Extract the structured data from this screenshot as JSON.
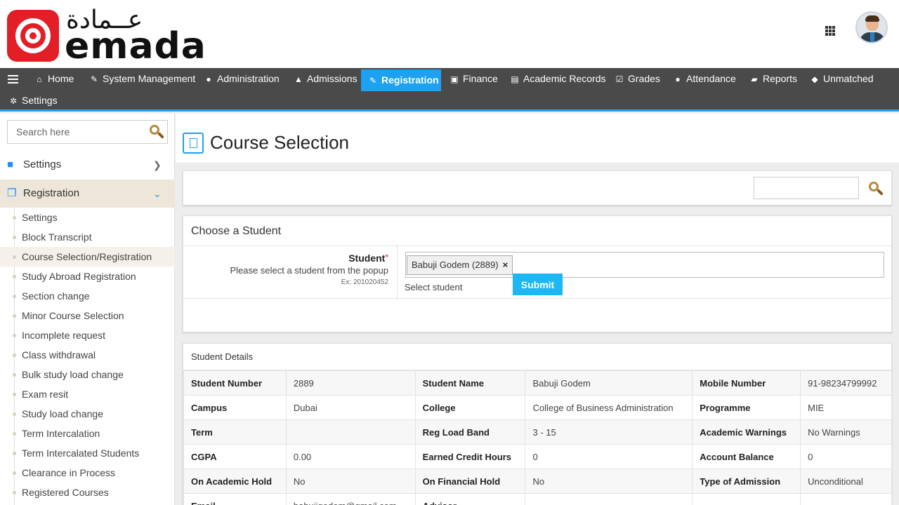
{
  "header": {
    "logo_arabic": "عــمادة",
    "logo_latin": "emada"
  },
  "nav": {
    "items": [
      {
        "label": "Home",
        "icon": "home-icon"
      },
      {
        "label": "System Management",
        "icon": "wrench-icon"
      },
      {
        "label": "Administration",
        "icon": "user-icon"
      },
      {
        "label": "Admissions",
        "icon": "graduation-cap-icon"
      },
      {
        "label": "Registration",
        "icon": "edit-icon",
        "active": true
      },
      {
        "label": "Finance",
        "icon": "money-icon"
      },
      {
        "label": "Academic Records",
        "icon": "file-icon"
      },
      {
        "label": "Grades",
        "icon": "check-square-icon"
      },
      {
        "label": "Attendance",
        "icon": "user-icon"
      },
      {
        "label": "Reports",
        "icon": "folder-open-icon"
      },
      {
        "label": "Unmatched",
        "icon": "user-secret-icon"
      },
      {
        "label": "Settings",
        "icon": "gear-icon"
      }
    ],
    "active_color": "#1da1f2"
  },
  "sidebar": {
    "search_placeholder": "Search here",
    "sections": [
      {
        "label": "Settings",
        "icon": "folder-icon"
      },
      {
        "label": "Registration",
        "icon": "copy-icon"
      }
    ],
    "items": [
      "Settings",
      "Block Transcript",
      "Course Selection/Registration",
      "Study Abroad Registration",
      "Section change",
      "Minor Course Selection",
      "Incomplete request",
      "Class withdrawal",
      "Bulk study load change",
      "Exam resit",
      "Study load change",
      "Term Intercalation",
      "Term Intercalated Students",
      "Clearance in Process",
      "Registered Courses"
    ]
  },
  "main": {
    "page_title": "Course Selection",
    "choose": {
      "heading": "Choose a Student",
      "label": "Student",
      "required_mark": "*",
      "hint": "Please select a student from the popup",
      "example": "Ex: 201020452",
      "chip": "Babuji Godem (2889)",
      "chip_remove": "×",
      "help": "Select student",
      "submit": "Submit"
    },
    "details": {
      "heading": "Student Details",
      "rows": [
        [
          [
            "Student Number",
            "2889"
          ],
          [
            "Student Name",
            "Babuji Godem"
          ],
          [
            "Mobile Number",
            "91-98234799992"
          ]
        ],
        [
          [
            "Campus",
            "Dubai"
          ],
          [
            "College",
            "College of Business Administration"
          ],
          [
            "Programme",
            "MIE"
          ]
        ],
        [
          [
            "Term",
            ""
          ],
          [
            "Reg Load Band",
            "3 - 15"
          ],
          [
            "Academic Warnings",
            "No Warnings"
          ]
        ],
        [
          [
            "CGPA",
            "0.00"
          ],
          [
            "Earned Credit Hours",
            "0"
          ],
          [
            "Account Balance",
            "0"
          ]
        ],
        [
          [
            "On Academic Hold",
            "No"
          ],
          [
            "On Financial Hold",
            "No"
          ],
          [
            "Type of Admission",
            "Unconditional"
          ]
        ],
        [
          [
            "Email",
            "babujigodem@gmail.com"
          ],
          [
            "Advisor",
            ""
          ],
          [
            "",
            ""
          ]
        ]
      ]
    }
  }
}
